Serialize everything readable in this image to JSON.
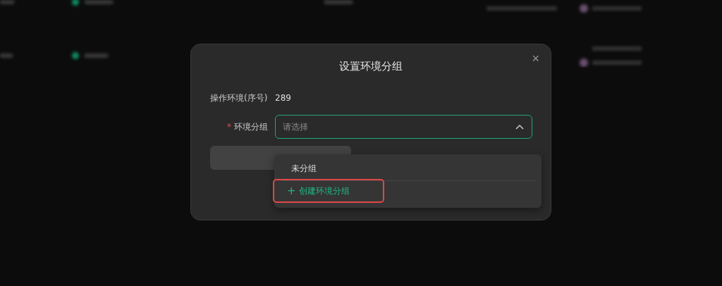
{
  "dialog": {
    "title": "设置环境分组",
    "close_icon": "×"
  },
  "env_row": {
    "label": "操作环境(序号)",
    "value": "289"
  },
  "group_field": {
    "required_mark": "*",
    "label": "环境分组",
    "placeholder": "请选择",
    "expanded": true
  },
  "dropdown": {
    "options": [
      {
        "label": "未分组",
        "kind": "option",
        "highlighted": false
      },
      {
        "label": "创建环境分组",
        "icon": "+",
        "kind": "create",
        "highlighted": true
      }
    ]
  }
}
